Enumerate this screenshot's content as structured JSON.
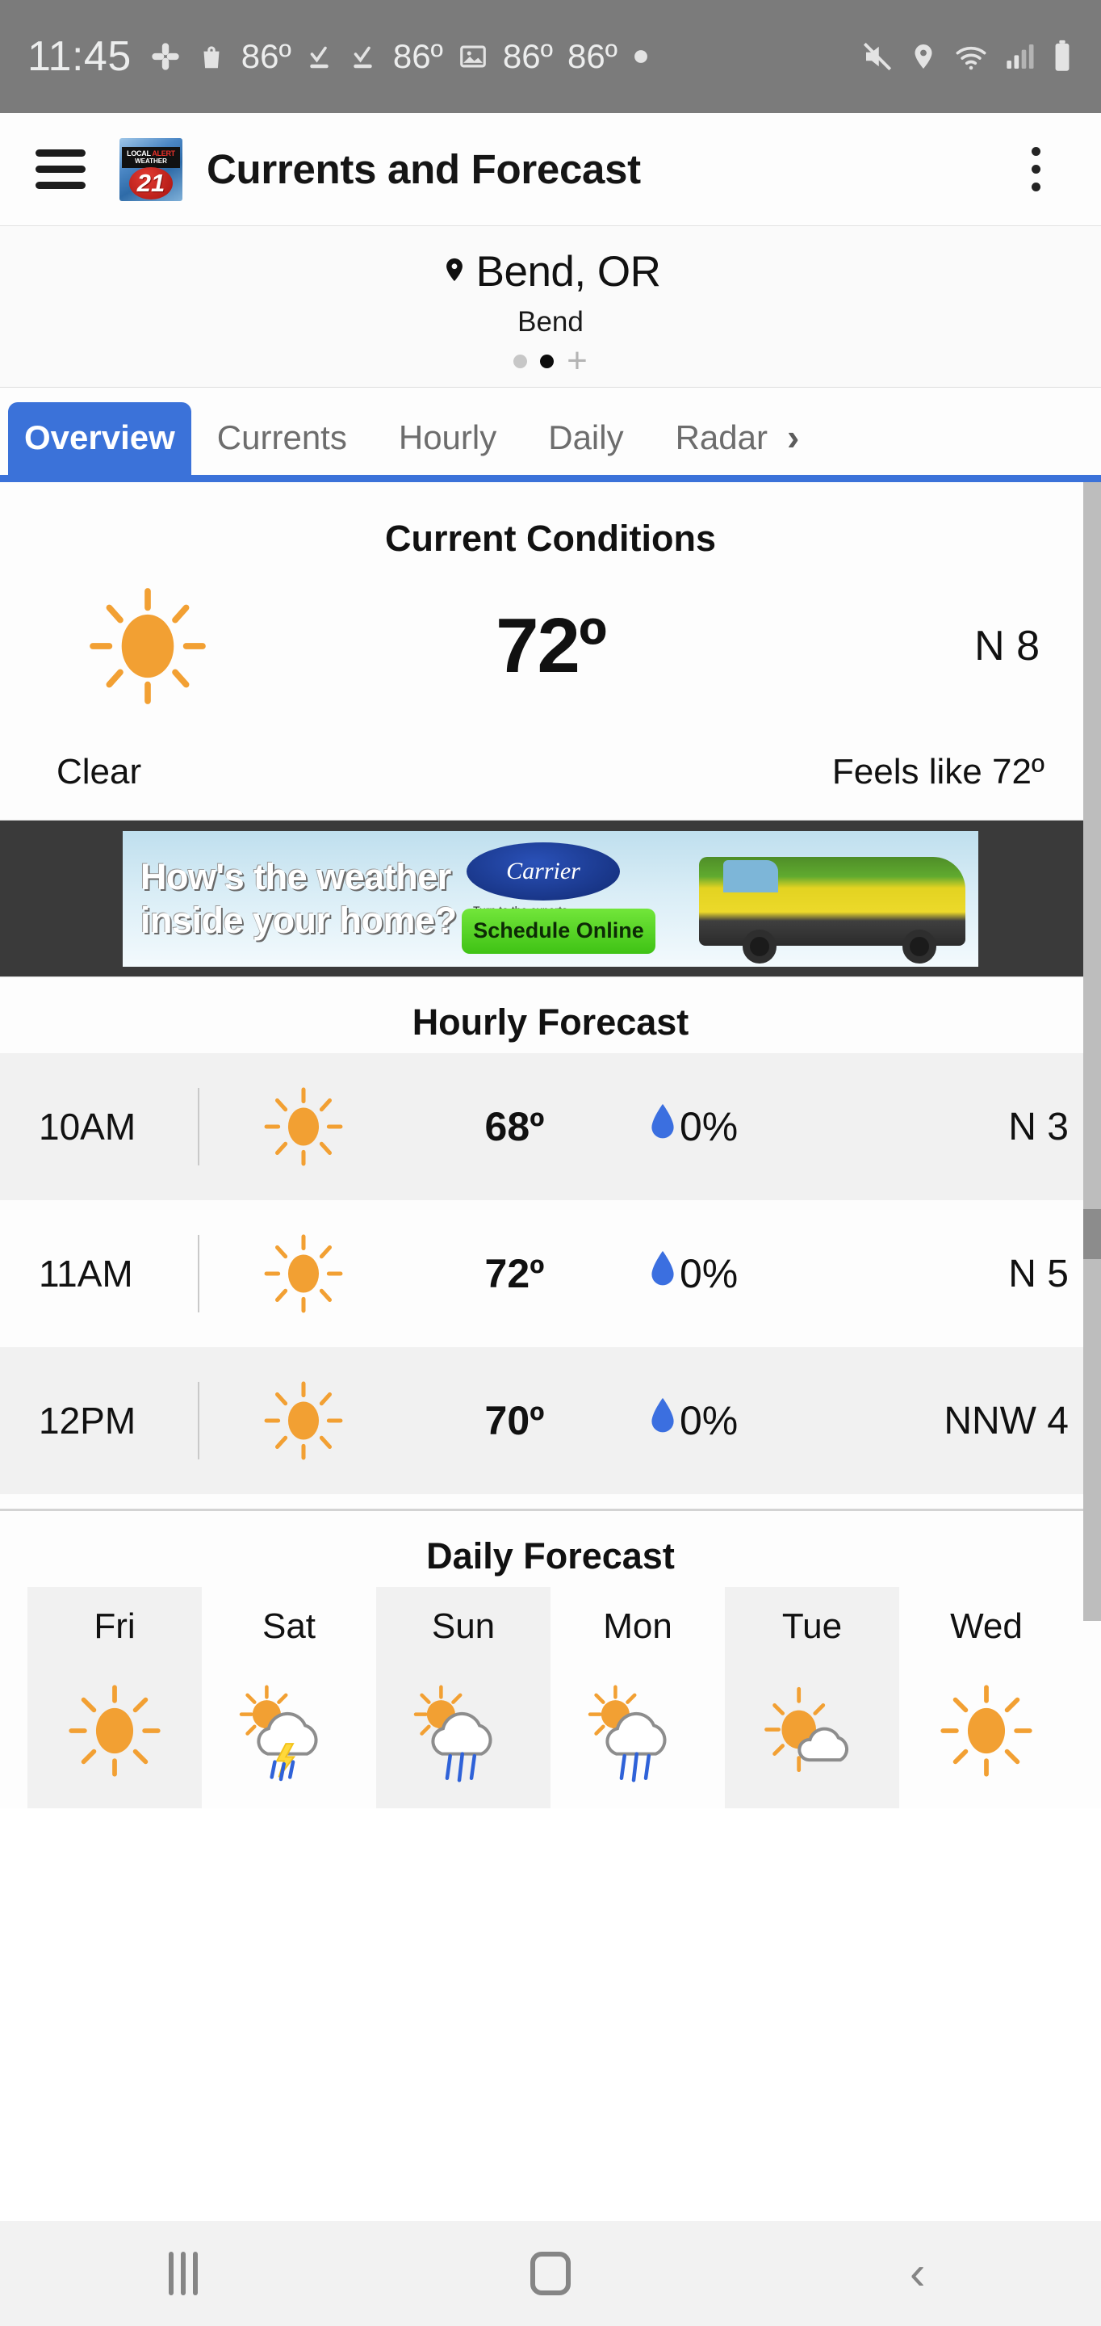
{
  "statusbar": {
    "time": "11:45",
    "icons": [
      "slack-icon",
      "shopping-bag-icon"
    ],
    "temps": [
      "86º",
      "86º",
      "86º",
      "86º"
    ],
    "right_icons": [
      "mute-icon",
      "location-icon",
      "wifi-icon",
      "signal-icon",
      "battery-icon"
    ],
    "background": "#7b7b7b"
  },
  "appbar": {
    "menu_icon": "hamburger-icon",
    "logo": {
      "line1_a": "LOCAL ",
      "line1_b": "ALERT",
      "line2": "WEATHER",
      "channel": "21"
    },
    "title": "Currents and Forecast",
    "overflow_icon": "kebab-menu-icon"
  },
  "location": {
    "pin_icon": "location-pin-icon",
    "name": "Bend, OR",
    "sub": "Bend",
    "add_label": "+",
    "dots": 2,
    "active_dot": 1
  },
  "tabs": {
    "items": [
      {
        "label": "Overview",
        "active": true
      },
      {
        "label": "Currents",
        "active": false
      },
      {
        "label": "Hourly",
        "active": false
      },
      {
        "label": "Daily",
        "active": false
      },
      {
        "label": "Radar",
        "active": false
      }
    ],
    "more_arrow": "›",
    "accent": "#3b72d9"
  },
  "current": {
    "title": "Current Conditions",
    "icon": "sun-icon",
    "temp": "72º",
    "wind": "N  8",
    "condition": "Clear",
    "feels_like": "Feels like 72º"
  },
  "ad": {
    "line1": "How's the weather",
    "line2": "inside your home?",
    "brand": "Carrier",
    "brand_tagline": "Turn to the experts",
    "cta": "Schedule Online",
    "background": "#3a3a3a"
  },
  "hourly": {
    "title": "Hourly Forecast",
    "rows": [
      {
        "time": "10AM",
        "icon": "sun-icon",
        "temp": "68º",
        "precip": "0%",
        "wind": "N  3"
      },
      {
        "time": "11AM",
        "icon": "sun-icon",
        "temp": "72º",
        "precip": "0%",
        "wind": "N  5"
      },
      {
        "time": "12PM",
        "icon": "sun-icon",
        "temp": "70º",
        "precip": "0%",
        "wind": "NNW  4"
      }
    ],
    "precip_icon": "water-droplet-icon",
    "droplet_color": "#3b6fe0"
  },
  "daily": {
    "title": "Daily Forecast",
    "days": [
      {
        "name": "Fri",
        "icon": "sun-icon"
      },
      {
        "name": "Sat",
        "icon": "sun-cloud-thunderstorm-icon"
      },
      {
        "name": "Sun",
        "icon": "sun-cloud-rain-icon"
      },
      {
        "name": "Mon",
        "icon": "sun-cloud-rain-icon"
      },
      {
        "name": "Tue",
        "icon": "sun-cloud-icon"
      },
      {
        "name": "Wed",
        "icon": "sun-icon"
      }
    ]
  },
  "navbar": {
    "recents": "recents-icon",
    "home": "home-icon",
    "back": "back-icon"
  },
  "colors": {
    "sun": "#f2a033",
    "accent_blue": "#3b72d9",
    "droplet_blue": "#3b6fe0",
    "rain_blue": "#2f62d8"
  }
}
